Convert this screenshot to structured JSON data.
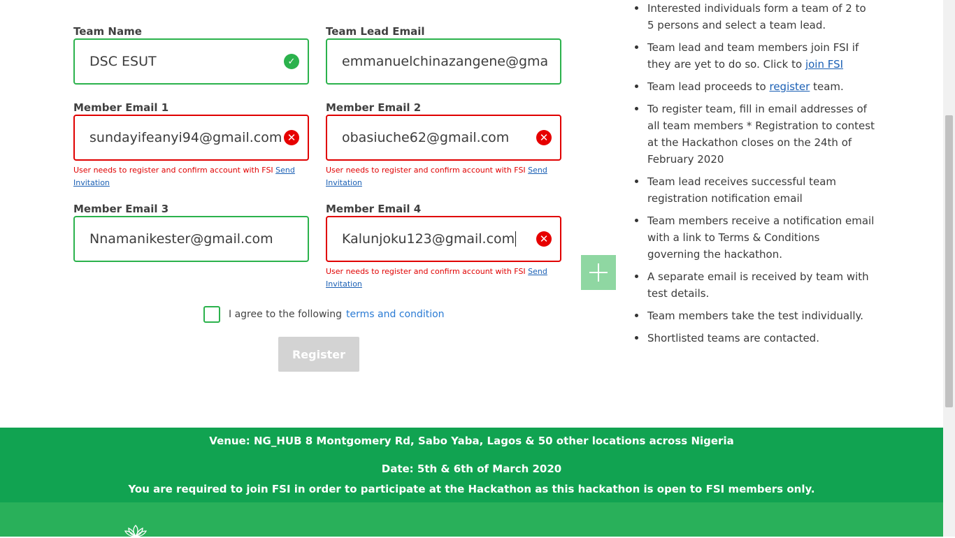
{
  "form": {
    "team_name": {
      "label": "Team Name",
      "value": "DSC ESUT",
      "status": "valid"
    },
    "team_lead_email": {
      "label": "Team Lead Email",
      "value": "emmanuelchinazangene@gma",
      "status": "valid"
    },
    "member_1": {
      "label": "Member Email 1",
      "value": "sundayifeanyi94@gmail.com",
      "status": "error",
      "error": "User needs to register and confirm account with FSI",
      "link": "Send Invitation"
    },
    "member_2": {
      "label": "Member Email 2",
      "value": "obasiuche62@gmail.com",
      "status": "error",
      "error": "User needs to register and confirm account with FSI",
      "link": "Send Invitation"
    },
    "member_3": {
      "label": "Member Email 3",
      "value": "Nnamanikester@gmail.com",
      "status": "valid"
    },
    "member_4": {
      "label": "Member Email 4",
      "value": "Kalunjoku123@gmail.com",
      "status": "error",
      "error": "User needs to register and confirm account with FSI",
      "link": "Send Invitation"
    },
    "agree_text": "I agree to the following",
    "agree_link": "terms and condition",
    "agree_checked": false,
    "register_label": "Register",
    "register_enabled": false
  },
  "icons": {
    "valid": "check-circle-icon",
    "error": "x-circle-icon",
    "add_member": "plus-icon",
    "footer_logo": "lotus-logo-icon"
  },
  "steps": {
    "s1": "Interested individuals form a team of 2 to 5 persons and select a team lead.",
    "s2_text": "Team lead and team members join FSI if they are yet to do so. Click to",
    "s2_link": "join FSI",
    "s3_before": "Team lead proceeds to",
    "s3_link": "register",
    "s3_after": "team.",
    "s4": "To register team, fill in email addresses of all team members * Registration to contest at the Hackathon closes on the 24th of February 2020",
    "s5": "Team lead receives successful team registration notification email",
    "s6": "Team members receive a notification email with a link to Terms & Conditions governing the hackathon.",
    "s7": "A separate email is received by team with test details.",
    "s8": "Team members take the test individually.",
    "s9": "Shortlisted teams are contacted."
  },
  "footer": {
    "venue": "Venue: NG_HUB 8 Montgomery Rd, Sabo Yaba, Lagos & 50 other locations across Nigeria",
    "date": "Date: 5th & 6th of March 2020",
    "notice": "You are required to join FSI in order to participate at the Hackathon as this hackathon is open to FSI members only."
  },
  "colors": {
    "valid_border": "#2bb24c",
    "error_border": "#e00000",
    "footer_green": "#11a351",
    "band_green": "#29b05a",
    "link_blue": "#1a5fb4",
    "register_disabled": "#d3d3d3"
  }
}
